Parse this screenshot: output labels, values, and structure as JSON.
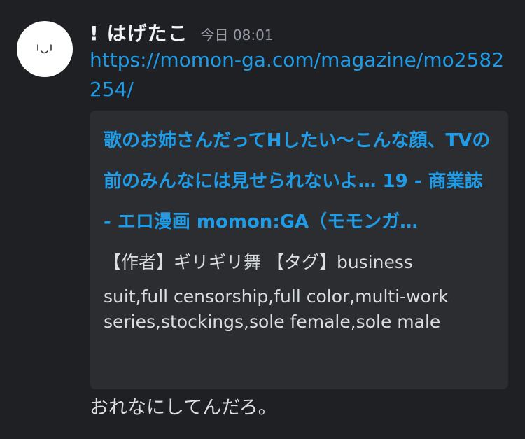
{
  "message": {
    "username": "! はげたこ",
    "timestamp": "今日 08:01",
    "link": "https://momon-ga.com/magazine/mo2582254/",
    "embed": {
      "title": "歌のお姉さんだってHしたい〜こんな顔、TVの前のみんなには見せられないよ… 19 - 商業誌 - エロ漫画 momon:GA（モモンガ…",
      "description_first": "【作者】ギリギリ舞 【タグ】business",
      "description_rest": "suit,full censorship,full color,multi-work series,stockings,sole female,sole male"
    },
    "text": "おれなにしてんだろ。"
  },
  "avatar": {
    "icon": "face-icon",
    "background": "#ffffff"
  },
  "colors": {
    "background": "#1f2024",
    "embed_background": "#2b2d31",
    "link": "#1f9ce8",
    "username": "#f2f3f5",
    "timestamp": "#949ba4",
    "text": "#dbdee1"
  }
}
